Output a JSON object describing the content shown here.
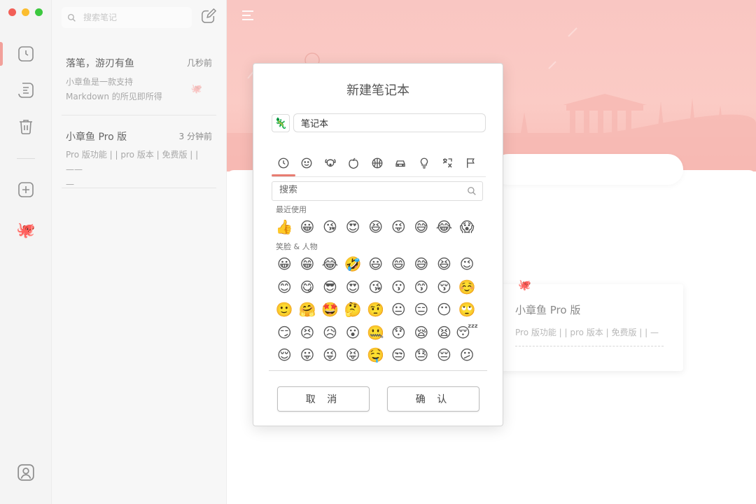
{
  "window": {
    "controls": [
      "#f25f57",
      "#fbbd2f",
      "#3cc83f"
    ]
  },
  "rail": {
    "accent": "#f2a09a",
    "icons": [
      "clock-icon",
      "notes-icon",
      "trash-icon",
      "add-icon",
      "octopus-icon",
      "user-icon"
    ]
  },
  "list": {
    "search_placeholder": "搜索笔记",
    "notes": [
      {
        "title": "落笔，游刃有鱼",
        "time": "几秒前",
        "lines": [
          "小章鱼是一款支持",
          "Markdown 的所见即所得"
        ]
      },
      {
        "title": "小章鱼 Pro 版",
        "time": "3 分钟前",
        "lines": [
          "Pro 版功能 | | pro 版本 | 免费版 | | ——",
          "—"
        ]
      }
    ]
  },
  "main": {
    "banner_color": "#f9c6c2",
    "card": {
      "title": "小章鱼 Pro 版",
      "subtitle": "Pro 版功能 | | pro 版本 | 免费版 | | —"
    }
  },
  "modal": {
    "title": "新建笔记本",
    "notebook_icon": "🦎",
    "name_value": "笔记本",
    "tabs": [
      "recent-icon",
      "smiley-icon",
      "animal-icon",
      "food-icon",
      "sports-icon",
      "travel-icon",
      "objects-icon",
      "symbols-icon",
      "flags-icon"
    ],
    "active_tab_color": "#e87c71",
    "emoji_search_placeholder": "搜索",
    "recent_label": "最近使用",
    "recent": [
      "👍",
      "😀",
      "😘",
      "😍",
      "😆",
      "😜",
      "😅",
      "😂",
      "😱"
    ],
    "people_label": "笑脸 & 人物",
    "people": [
      "😀",
      "😁",
      "😂",
      "🤣",
      "😃",
      "😄",
      "😅",
      "😆",
      "😉",
      "😊",
      "😋",
      "😎",
      "😍",
      "😘",
      "😗",
      "😙",
      "😚",
      "☺️",
      "🙂",
      "🤗",
      "🤩",
      "🤔",
      "🤨",
      "😐",
      "😑",
      "😶",
      "🙄",
      "😏",
      "😣",
      "😥",
      "😮",
      "🤐",
      "😯",
      "😪",
      "😫",
      "😴",
      "😌",
      "😛",
      "😜",
      "😝",
      "🤤",
      "😒",
      "😓",
      "😔",
      "😕"
    ],
    "cancel_label": "取 消",
    "confirm_label": "确 认"
  }
}
